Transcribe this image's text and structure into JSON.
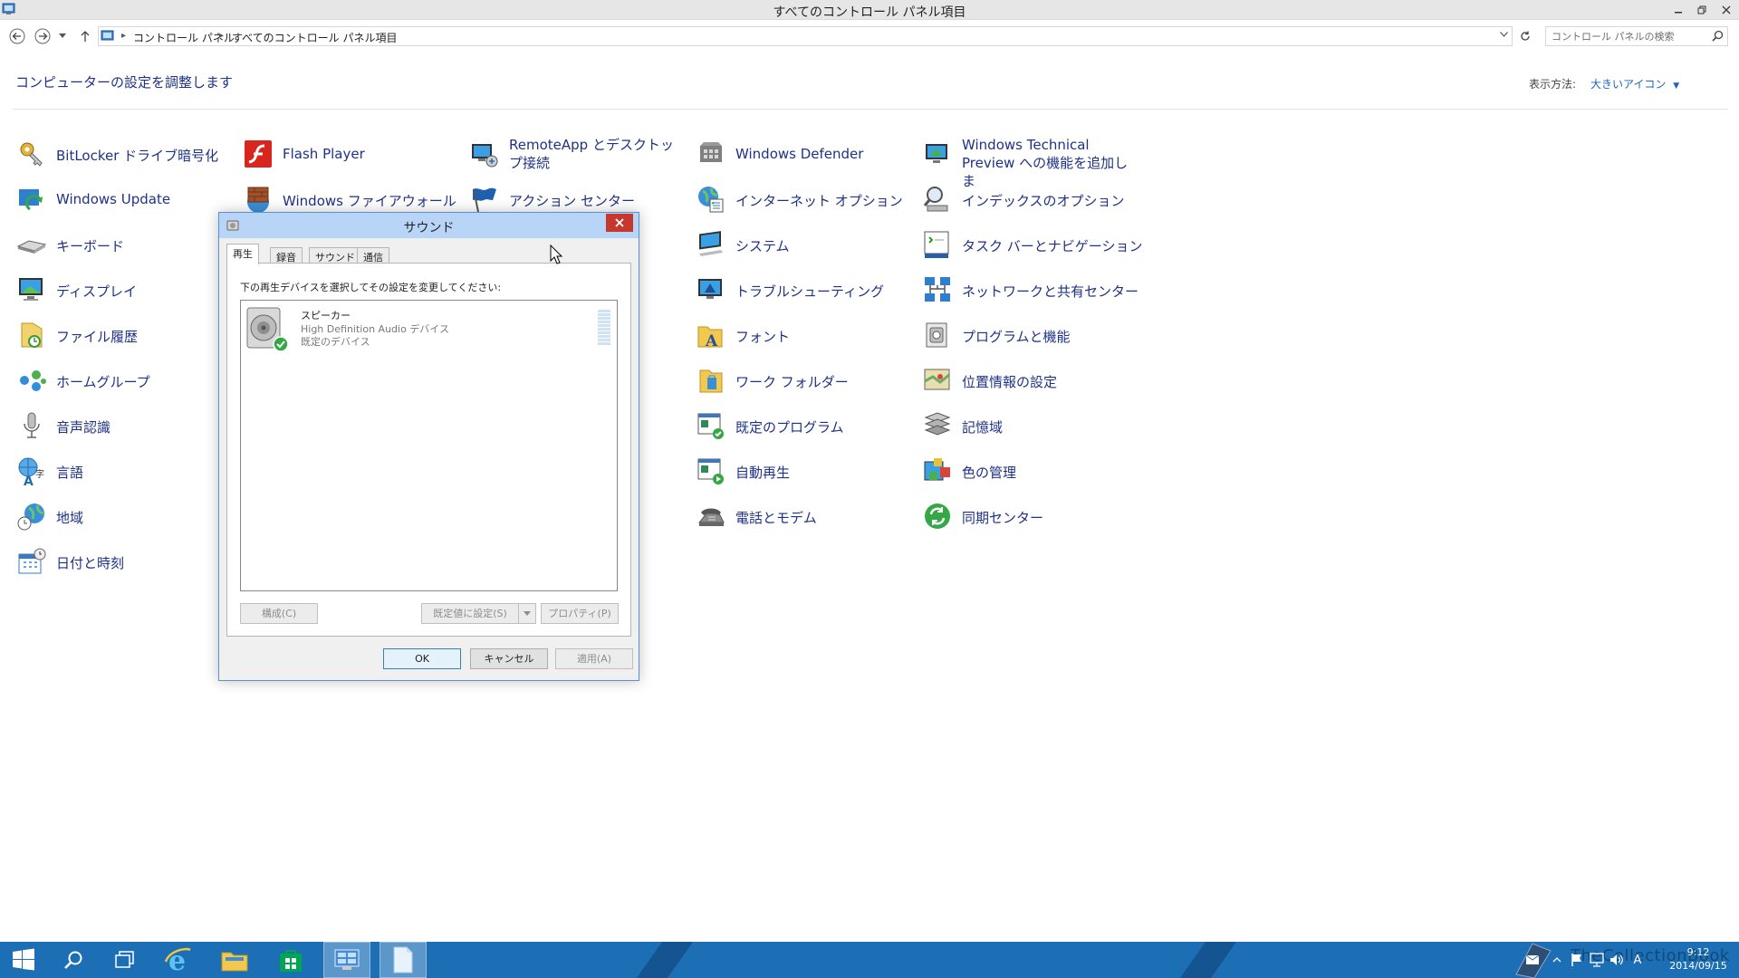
{
  "window": {
    "title": "すべてのコントロール パネル項目"
  },
  "address": {
    "crumbs": [
      "コントロール パネル",
      "すべてのコントロール パネル項目"
    ],
    "search_placeholder": "コントロール パネルの検索"
  },
  "header": {
    "title": "コンピューターの設定を調整します",
    "view_label": "表示方法:",
    "view_value": "大きいアイコン"
  },
  "items": {
    "bitlocker": "BitLocker ドライブ暗号化",
    "flash": "Flash Player",
    "remoteapp": "RemoteApp とデスクトップ接続",
    "defender": "Windows Defender",
    "technical_preview": "Windows Technical Preview への機能を追加しま",
    "windows_update": "Windows Update",
    "firewall": "Windows ファイアウォール",
    "action_center": "アクション センター",
    "internet_options": "インターネット オプション",
    "indexing": "インデックスのオプション",
    "keyboard": "キーボード",
    "system": "システム",
    "taskbar_nav": "タスク バーとナビゲーション",
    "display": "ディスプレイ",
    "troubleshooting": "トラブルシューティング",
    "network": "ネットワークと共有センター",
    "file_history": "ファイル履歴",
    "fonts": "フォント",
    "programs": "プログラムと機能",
    "homegroup": "ホームグループ",
    "work_folders": "ワーク フォルダー",
    "location": "位置情報の設定",
    "speech": "音声認識",
    "default_programs": "既定のプログラム",
    "storage": "記憶域",
    "language": "言語",
    "autoplay": "自動再生",
    "color": "色の管理",
    "region": "地域",
    "phone_modem": "電話とモデム",
    "sync": "同期センター",
    "datetime": "日付と時刻"
  },
  "dialog": {
    "title": "サウンド",
    "tabs": [
      "再生",
      "録音",
      "サウンド",
      "通信"
    ],
    "instruction": "下の再生デバイスを選択してその設定を変更してください:",
    "device": {
      "name": "スピーカー",
      "description": "High Definition Audio デバイス",
      "status": "既定のデバイス"
    },
    "buttons": {
      "configure": "構成(C)",
      "set_default": "既定値に設定(S)",
      "properties": "プロパティ(P)",
      "ok": "OK",
      "cancel": "キャンセル",
      "apply": "適用(A)"
    }
  },
  "taskbar": {
    "clock_time": "9:12",
    "clock_date": "2014/09/15",
    "ime": "A",
    "watermark": "TheCollectionBook"
  }
}
